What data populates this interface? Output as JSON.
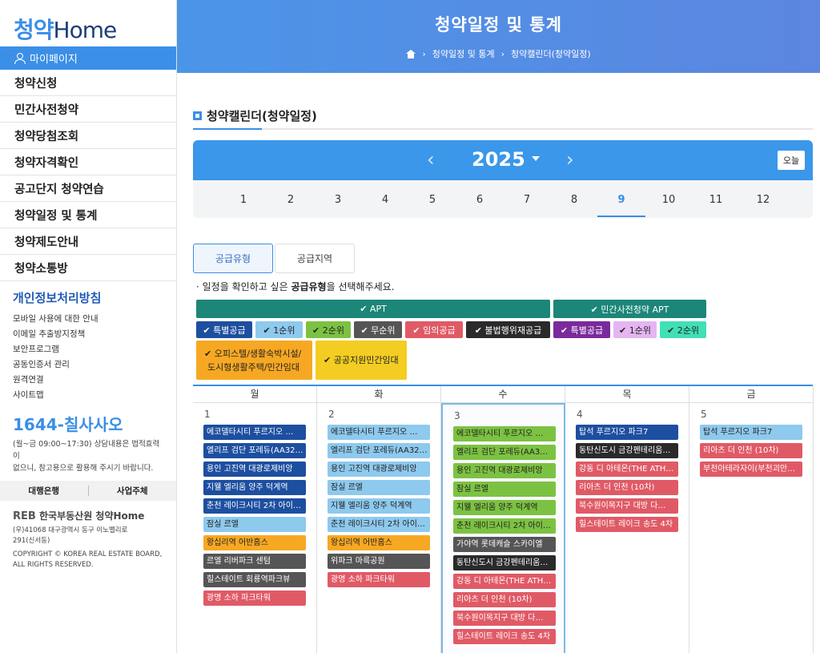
{
  "sidebar": {
    "logo_main": "청약",
    "logo_home": "Home",
    "mypage": "마이페이지",
    "menu": [
      "청약신청",
      "민간사전청약",
      "청약당첨조회",
      "청약자격확인",
      "공고단지 청약연습",
      "청약일정 및 통계",
      "청약제도안내",
      "청약소통방"
    ],
    "privacy_title": "개인정보처리방침",
    "links": [
      "모바일 사용에 대한 안내",
      "이메일 추출방지정책",
      "보안프로그램",
      "공동인증서 관리",
      "원격연결",
      "사이트맵"
    ],
    "phone": "1644-칠사사오",
    "hours_line1": "(월~금 09:00~17:30) 상담내용은 법적효력이",
    "hours_line2": "없으니, 참고용으로 활용해 주시기 바랍니다.",
    "bank_button": "대행은행",
    "business_button": "사업주체",
    "org_reb": "REB",
    "org_name": "한국부동산원 청약Home",
    "address_line1": "(우)41068 대구광역시 동구 이노밸리로",
    "address_line2": "291(신서동)",
    "copyright_line1": "COPYRIGHT © KOREA REAL ESTATE BOARD,",
    "copyright_line2": "ALL RIGHTS RESERVED."
  },
  "header": {
    "title": "청약일정 및 통계",
    "breadcrumb1": "청약일정 및 통계",
    "breadcrumb2": "청약캘린더(청약일정)"
  },
  "main": {
    "section_title": "청약캘린더(청약일정)",
    "year": "2025",
    "today_label": "오늘",
    "months": [
      "1",
      "2",
      "3",
      "4",
      "5",
      "6",
      "7",
      "8",
      "9",
      "10",
      "11",
      "12"
    ],
    "selected_month": "9",
    "tab_type": "공급유형",
    "tab_region": "공급지역",
    "instruction_pre": "· 일정을 확인하고 싶은 ",
    "instruction_bold": "공급유형",
    "instruction_post": "을 선택해주세요.",
    "apt_header": "✔ APT",
    "presale_header": "✔ 민간사전청약 APT",
    "apt_chips": [
      {
        "label": "✔ 특별공급",
        "color": "#1d4fa0",
        "text": "#ffffff"
      },
      {
        "label": "✔ 1순위",
        "color": "#8ec9ee",
        "text": "#222222"
      },
      {
        "label": "✔ 2순위",
        "color": "#7cc242",
        "text": "#222222"
      },
      {
        "label": "✔ 무순위",
        "color": "#555555",
        "text": "#ffffff"
      },
      {
        "label": "✔ 임의공급",
        "color": "#e05a66",
        "text": "#ffffff"
      },
      {
        "label": "✔ 불법행위재공급",
        "color": "#2a2a2a",
        "text": "#ffffff"
      }
    ],
    "presale_chips": [
      {
        "label": "✔ 특별공급",
        "color": "#7a2a9c",
        "text": "#ffffff"
      },
      {
        "label": "✔ 1순위",
        "color": "#e5b5f2",
        "text": "#222222"
      },
      {
        "label": "✔ 2순위",
        "color": "#40e0b5",
        "text": "#222222"
      }
    ],
    "officetel_line1": "✔ 오피스텔/생활숙박시설/",
    "officetel_line2": "도시형생활주택/민간임대",
    "public_rental": "✔ 공공지원민간임대",
    "officetel_color": "#f7a823",
    "public_rental_color": "#f4cd22"
  },
  "calendar": {
    "weekdays": [
      "월",
      "화",
      "수",
      "목",
      "금"
    ],
    "days": [
      {
        "num": "1",
        "events": [
          {
            "t": "에코델타시티 푸르지오 …",
            "c": "#1d4fa0",
            "f": "#ffffff"
          },
          {
            "t": "엘리프 검단 포레듀(AA32…",
            "c": "#1d4fa0",
            "f": "#ffffff"
          },
          {
            "t": "용인 고진역 대광로제비앙",
            "c": "#1d4fa0",
            "f": "#ffffff"
          },
          {
            "t": "지웰 엘리움 양주 덕계역",
            "c": "#1d4fa0",
            "f": "#ffffff"
          },
          {
            "t": "춘천 레이크시티 2차 아이…",
            "c": "#1d4fa0",
            "f": "#ffffff"
          },
          {
            "t": "잠실 르엘",
            "c": "#8ec9ee",
            "f": "#222222"
          },
          {
            "t": "왕십리역 어반홈스",
            "c": "#f7a823",
            "f": "#222222"
          },
          {
            "t": "르엘 리버파크 센텀",
            "c": "#555555",
            "f": "#ffffff"
          },
          {
            "t": "힐스테이트 회룡역파크뷰",
            "c": "#555555",
            "f": "#ffffff"
          },
          {
            "t": "광명 소하 파크타워",
            "c": "#e05a66",
            "f": "#ffffff"
          }
        ]
      },
      {
        "num": "2",
        "events": [
          {
            "t": "에코델타시티 푸르지오 …",
            "c": "#8ec9ee",
            "f": "#222222"
          },
          {
            "t": "엘리프 검단 포레듀(AA32…",
            "c": "#8ec9ee",
            "f": "#222222"
          },
          {
            "t": "용인 고진역 대광로제비앙",
            "c": "#8ec9ee",
            "f": "#222222"
          },
          {
            "t": "잠실 르엘",
            "c": "#8ec9ee",
            "f": "#222222"
          },
          {
            "t": "지웰 엘리움 양주 덕계역",
            "c": "#8ec9ee",
            "f": "#222222"
          },
          {
            "t": "춘천 레이크시티 2차 아이…",
            "c": "#8ec9ee",
            "f": "#222222"
          },
          {
            "t": "왕십리역 어반홈스",
            "c": "#f7a823",
            "f": "#222222"
          },
          {
            "t": "위파크 마륵공원",
            "c": "#555555",
            "f": "#ffffff"
          },
          {
            "t": "광명 소하 파크타워",
            "c": "#e05a66",
            "f": "#ffffff"
          }
        ]
      },
      {
        "num": "3",
        "events": [
          {
            "t": "에코델타시티 푸르지오 …",
            "c": "#7cc242",
            "f": "#222222"
          },
          {
            "t": "엘리프 검단 포레듀(AA3…",
            "c": "#7cc242",
            "f": "#222222"
          },
          {
            "t": "용인 고진역 대광로제비앙",
            "c": "#7cc242",
            "f": "#222222"
          },
          {
            "t": "잠실 르엘",
            "c": "#7cc242",
            "f": "#222222"
          },
          {
            "t": "지웰 엘리움 양주 덕계역",
            "c": "#7cc242",
            "f": "#222222"
          },
          {
            "t": "춘천 레이크시티 2차 아이…",
            "c": "#7cc242",
            "f": "#222222"
          },
          {
            "t": "가야역 롯데캐슬 스카이엘",
            "c": "#555555",
            "f": "#ffffff"
          },
          {
            "t": "동탄신도시 금강펜테리움…",
            "c": "#2a2a2a",
            "f": "#ffffff"
          },
          {
            "t": "강동 디 아테온(THE ATH…",
            "c": "#e05a66",
            "f": "#ffffff"
          },
          {
            "t": "리아츠 더 인천 (10차)",
            "c": "#e05a66",
            "f": "#ffffff"
          },
          {
            "t": "북수원이목지구 대방 다…",
            "c": "#e05a66",
            "f": "#ffffff"
          },
          {
            "t": "힐스테이트 레이크 송도 4차",
            "c": "#e05a66",
            "f": "#ffffff"
          }
        ]
      },
      {
        "num": "4",
        "events": [
          {
            "t": "탑석 푸르지오 파크7",
            "c": "#1d4fa0",
            "f": "#ffffff"
          },
          {
            "t": "동탄신도시 금강펜테리움…",
            "c": "#2a2a2a",
            "f": "#ffffff"
          },
          {
            "t": "강동 디 아테온(THE ATH…",
            "c": "#e05a66",
            "f": "#ffffff"
          },
          {
            "t": "리아츠 더 인천 (10차)",
            "c": "#e05a66",
            "f": "#ffffff"
          },
          {
            "t": "북수원이목지구 대방 다…",
            "c": "#e05a66",
            "f": "#ffffff"
          },
          {
            "t": "힐스테이트 레이크 송도 4차",
            "c": "#e05a66",
            "f": "#ffffff"
          }
        ]
      },
      {
        "num": "5",
        "events": [
          {
            "t": "탑석 푸르지오 파크7",
            "c": "#8ec9ee",
            "f": "#222222"
          },
          {
            "t": "리아츠 더 인천 (10차)",
            "c": "#e05a66",
            "f": "#ffffff"
          },
          {
            "t": "부천아테라자이(부천괴안…",
            "c": "#e05a66",
            "f": "#ffffff"
          }
        ]
      }
    ]
  }
}
